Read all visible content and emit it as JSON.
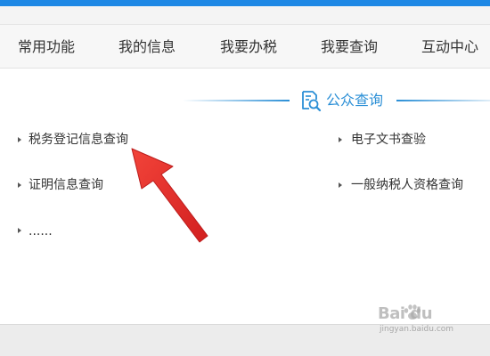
{
  "nav": {
    "items": [
      {
        "label": "常用功能"
      },
      {
        "label": "我的信息"
      },
      {
        "label": "我要办税"
      },
      {
        "label": "我要查询"
      },
      {
        "label": "互动中心"
      }
    ]
  },
  "section": {
    "title": "公众查询",
    "icon": "search-document-icon"
  },
  "links": {
    "left": [
      {
        "label": "税务登记信息查询"
      },
      {
        "label": "证明信息查询"
      },
      {
        "label": "......"
      }
    ],
    "right": [
      {
        "label": "电子文书查验"
      },
      {
        "label": "一般纳税人资格查询"
      }
    ]
  },
  "annotation": {
    "arrow_color": "#e8201e"
  },
  "watermark": {
    "text": "Bai du",
    "sub": "jingyan.baidu.com"
  },
  "colors": {
    "accent": "#2b8fd6",
    "top_bar": "#1e88e5"
  }
}
